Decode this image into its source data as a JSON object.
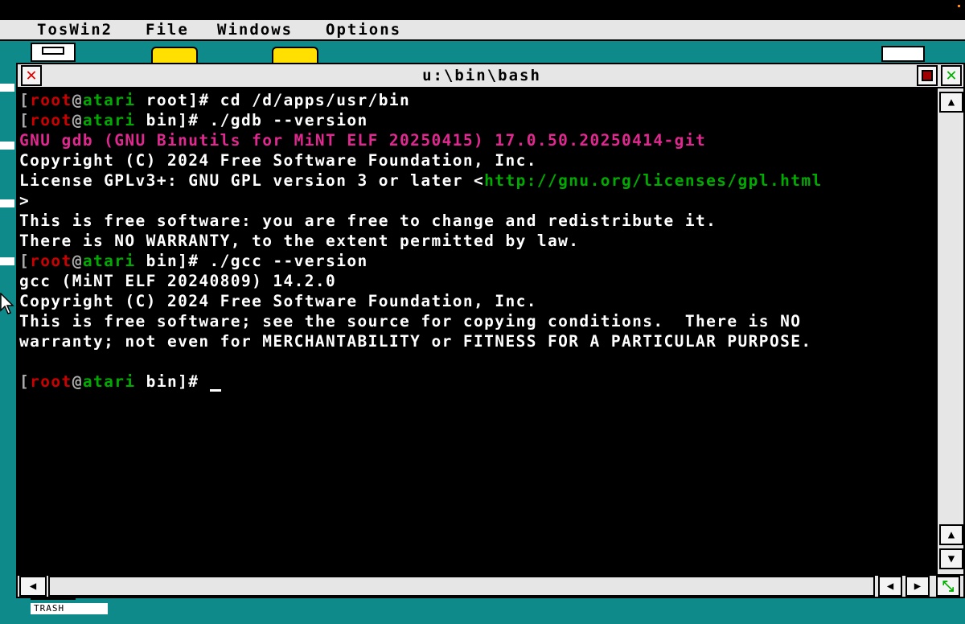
{
  "menubar": {
    "items": [
      {
        "label": "TosWin2"
      },
      {
        "label": "File"
      },
      {
        "label": "Windows"
      },
      {
        "label": "Options"
      }
    ]
  },
  "desktop": {
    "trash_label": "TRASH"
  },
  "window": {
    "title": "u:\\bin\\bash",
    "close_glyph": "✕",
    "fuller_glyph": "✕"
  },
  "terminal": {
    "prompt": {
      "lb": "[",
      "user": "root",
      "at": "@",
      "host": "atari"
    },
    "lines": [
      {
        "dir": " root]# ",
        "cmd": "cd /d/apps/usr/bin"
      },
      {
        "dir": " bin]# ",
        "cmd": "./gdb --version"
      },
      {
        "text": "GNU gdb (GNU Binutils for MiNT ELF 20250415) 17.0.50.20250414-git"
      },
      {
        "text": "Copyright (C) 2024 Free Software Foundation, Inc."
      },
      {
        "pre": "License GPLv3+: GNU GPL version 3 or later <",
        "link": "http://gnu.org/licenses/gpl.html"
      },
      {
        "text": ">"
      },
      {
        "text": "This is free software: you are free to change and redistribute it."
      },
      {
        "text": "There is NO WARRANTY, to the extent permitted by law."
      },
      {
        "dir": " bin]# ",
        "cmd": "./gcc --version"
      },
      {
        "text": "gcc (MiNT ELF 20240809) 14.2.0"
      },
      {
        "text": "Copyright (C) 2024 Free Software Foundation, Inc."
      },
      {
        "text": "This is free software; see the source for copying conditions.  There is NO"
      },
      {
        "text": "warranty; not even for MERCHANTABILITY or FITNESS FOR A PARTICULAR PURPOSE."
      },
      {
        "text": ""
      },
      {
        "dir": " bin]# ",
        "cmd": ""
      }
    ]
  },
  "colors": {
    "desktop": "#0f8a8a",
    "prompt_user": "#cc0000",
    "prompt_host": "#00aa00",
    "gdb_banner": "#e02890",
    "link": "#00aa00"
  },
  "icons": {
    "close": "close-icon",
    "iconify": "iconify-icon",
    "fuller": "fuller-icon",
    "scroll_up": "arrow-up-icon",
    "scroll_down": "arrow-down-icon",
    "scroll_left": "arrow-left-icon",
    "scroll_right": "arrow-right-icon",
    "sizer": "resize-icon"
  }
}
